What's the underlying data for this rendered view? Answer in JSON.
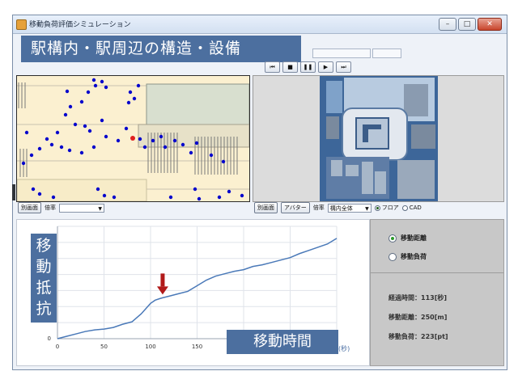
{
  "window": {
    "title": "移動負荷評価シミュレーション"
  },
  "banner": "駅構内・駅周辺の構造・設備",
  "player": {
    "buttons": [
      "⏮",
      "■",
      "❚❚",
      "▶",
      "⏭"
    ]
  },
  "left_panel": {
    "popup_label": "別画面",
    "zoom_label": "倍率",
    "zoom_value": ""
  },
  "right_panel": {
    "popup_label": "別画面",
    "avatar_label": "アバター",
    "zoom_label": "倍率",
    "zoom_value": "構内全体",
    "mode_options": [
      "フロア",
      "CAD"
    ],
    "selected_mode": "フロア"
  },
  "side": {
    "options": [
      "移動距離",
      "移動負荷"
    ],
    "selected": "移動距離",
    "elapsed": "経過時間：113[秒]",
    "distance": "移動距離：250[m]",
    "load": "移動負荷：223[pt]"
  },
  "graph_labels": {
    "y_axis_label": "移動抵抗",
    "x_axis_label": "移動時間",
    "x_unit": "(秒)"
  },
  "chart_data": {
    "type": "line",
    "x": [
      0,
      10,
      20,
      30,
      40,
      50,
      60,
      70,
      80,
      90,
      100,
      105,
      110,
      113,
      120,
      130,
      140,
      150,
      160,
      170,
      180,
      190,
      200,
      210,
      220,
      230,
      240,
      250,
      260,
      270,
      280,
      290,
      300
    ],
    "y": [
      0,
      3,
      6,
      9,
      11,
      12,
      14,
      18,
      21,
      31,
      44,
      48,
      50,
      51,
      53,
      56,
      59,
      66,
      73,
      78,
      81,
      84,
      86,
      90,
      92,
      95,
      98,
      101,
      106,
      110,
      114,
      118,
      125
    ],
    "x_ticks": [
      0,
      50,
      100,
      150
    ],
    "y_ticks": [
      0
    ],
    "xlim": [
      0,
      300
    ],
    "ylim": [
      0,
      140
    ],
    "grid": true,
    "annotation": {
      "type": "arrow",
      "x": 113,
      "color": "#b11a1a"
    },
    "line_color": "#4a79b8"
  },
  "colors": {
    "accent": "#4c6f9f",
    "map_bg": "#fbf0d0",
    "agent": "#0000cc",
    "selected_agent": "#e02020"
  }
}
